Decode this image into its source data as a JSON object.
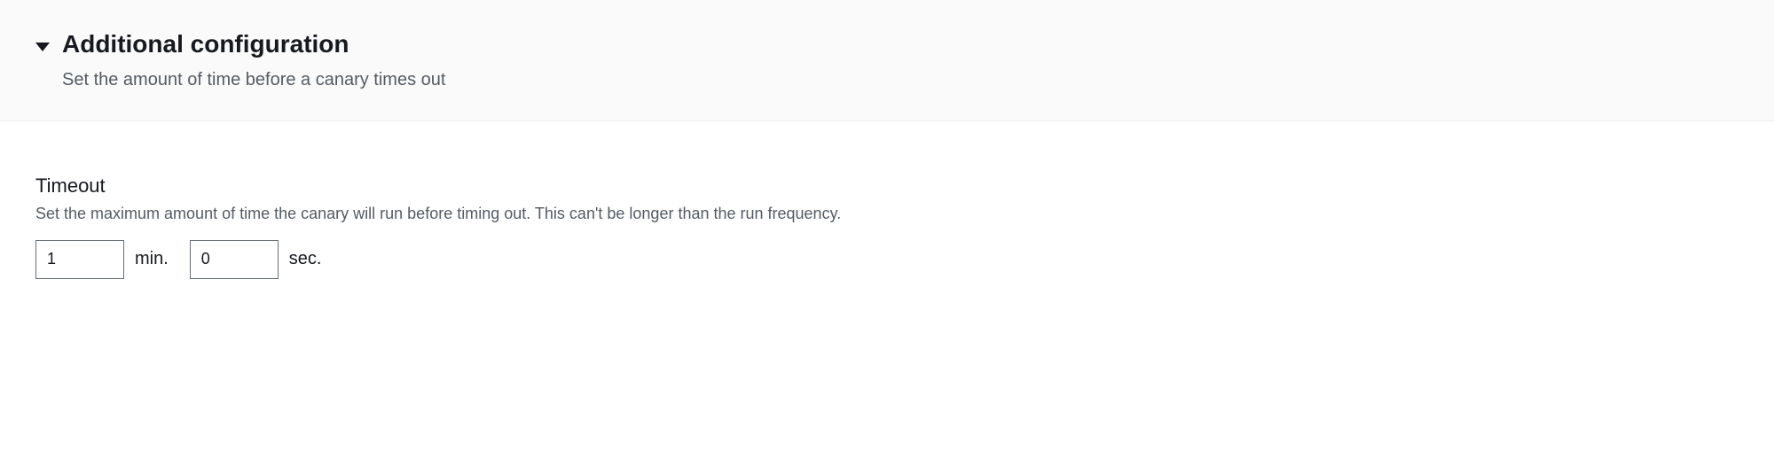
{
  "header": {
    "title": "Additional configuration",
    "subtitle": "Set the amount of time before a canary times out"
  },
  "timeout": {
    "label": "Timeout",
    "description": "Set the maximum amount of time the canary will run before timing out. This can't be longer than the run frequency.",
    "minutes_value": "1",
    "minutes_unit": "min.",
    "seconds_value": "0",
    "seconds_unit": "sec."
  }
}
